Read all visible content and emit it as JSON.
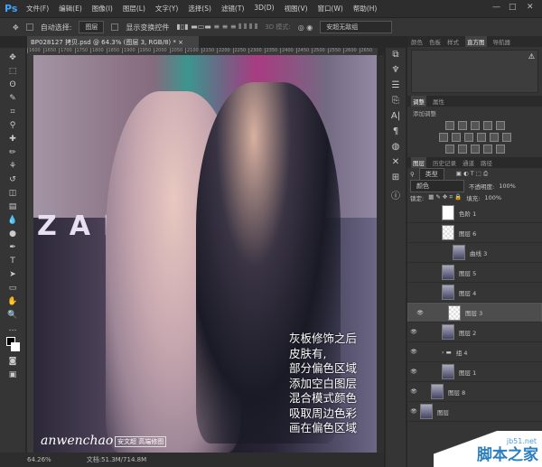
{
  "app": {
    "logo": "Ps",
    "menus": [
      "文件(F)",
      "编辑(E)",
      "图像(I)",
      "图层(L)",
      "文字(Y)",
      "选择(S)",
      "滤镜(T)",
      "3D(D)",
      "视图(V)",
      "窗口(W)",
      "帮助(H)"
    ]
  },
  "options": {
    "auto_select_label": "自动选择:",
    "auto_select_value": "图层",
    "show_transform_label": "显示变换控件",
    "mode_label": "3D 模式:",
    "workspace": "安超无敌组"
  },
  "document": {
    "tab_title": "BP028127 拷贝.psd @ 64.3% (图层 3, RGB/8) *",
    "ruler_ticks": [
      "1600",
      "1650",
      "1700",
      "1750",
      "1800",
      "1850",
      "1900",
      "1950",
      "2000",
      "2050",
      "2100",
      "2150",
      "2200",
      "2250",
      "2300",
      "2350",
      "2400",
      "2450",
      "2500",
      "2550",
      "2600",
      "2650"
    ]
  },
  "canvas": {
    "sign_text": "ZAI",
    "note_lines": [
      "灰板修饰之后",
      "皮肤有,",
      "部分偏色区域",
      "添加空白图层",
      "混合模式颜色",
      "吸取周边色彩",
      "画在偏色区域"
    ],
    "signature": "anwenchao",
    "signature_tag": "安文超 高端修图"
  },
  "status": {
    "zoom": "64.26%",
    "doc_size": "文档:51.3M/714.8M"
  },
  "panels": {
    "top_tabs": [
      "颜色",
      "色板",
      "样式",
      "直方图",
      "导航器"
    ],
    "top_active": 3,
    "adj_tabs": [
      "调整",
      "属性"
    ],
    "adj_title": "添加调整",
    "layer_tabs": [
      "图层",
      "历史记录",
      "通道",
      "路径"
    ],
    "filter": "类型",
    "blend_mode": "颜色",
    "opacity_label": "不透明度:",
    "opacity": "100%",
    "lock_label": "锁定:",
    "fill_label": "填充:",
    "fill": "100%",
    "layers": [
      {
        "name": "色阶 1",
        "visible": false,
        "thumb": "white",
        "indent": 2
      },
      {
        "name": "图层 6",
        "visible": false,
        "thumb": "check",
        "indent": 2
      },
      {
        "name": "曲线 3",
        "visible": false,
        "thumb": "photo",
        "indent": 3
      },
      {
        "name": "图层 5",
        "visible": false,
        "thumb": "photo",
        "indent": 2
      },
      {
        "name": "图层 4",
        "visible": false,
        "thumb": "photo",
        "indent": 2
      },
      {
        "name": "图层 3",
        "visible": true,
        "thumb": "check",
        "indent": 2,
        "selected": true
      },
      {
        "name": "图层 2",
        "visible": true,
        "thumb": "photo",
        "indent": 2
      },
      {
        "name": "组 4",
        "visible": true,
        "thumb": "folder",
        "indent": 2
      },
      {
        "name": "图层 1",
        "visible": true,
        "thumb": "photo",
        "indent": 2
      },
      {
        "name": "图层 8",
        "visible": true,
        "thumb": "photo",
        "indent": 1
      },
      {
        "name": "图层",
        "visible": true,
        "thumb": "photo",
        "indent": 0
      }
    ]
  },
  "watermark": {
    "site": "jb51.net",
    "name": "脚本之家"
  }
}
